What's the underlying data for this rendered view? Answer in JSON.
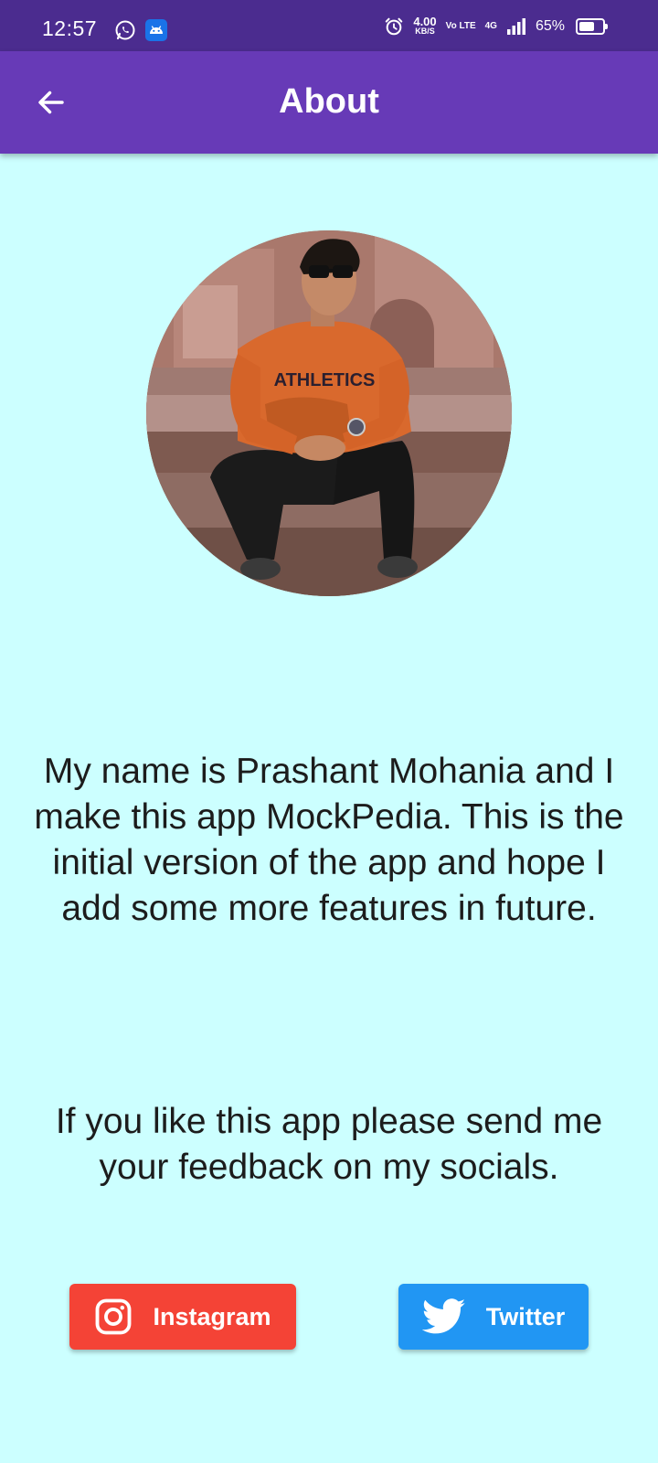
{
  "status_bar": {
    "time": "12:57",
    "net_speed_value": "4.00",
    "net_speed_unit": "KB/S",
    "volte": "Vo LTE",
    "network": "4G",
    "battery_percent": "65%",
    "battery_level": 0.65,
    "icons": [
      "whatsapp-icon",
      "android-app-icon",
      "alarm-icon",
      "signal-icon"
    ]
  },
  "app_bar": {
    "title": "About",
    "back_icon": "arrow-left-icon"
  },
  "profile": {
    "photo": "profile-photo"
  },
  "bio": {
    "paragraph_1": "My name is Prashant Mohania and I make this app MockPedia. This is the initial version of the app and hope I add some more features in future.",
    "paragraph_2": "If you like this app please send me your feedback on my socials."
  },
  "socials": {
    "instagram_label": "Instagram",
    "twitter_label": "Twitter"
  },
  "colors": {
    "app_bar": "#673ab7",
    "status_bar": "#4b2c8f",
    "background": "#ccffff",
    "instagram": "#f44336",
    "twitter": "#2196f3"
  }
}
